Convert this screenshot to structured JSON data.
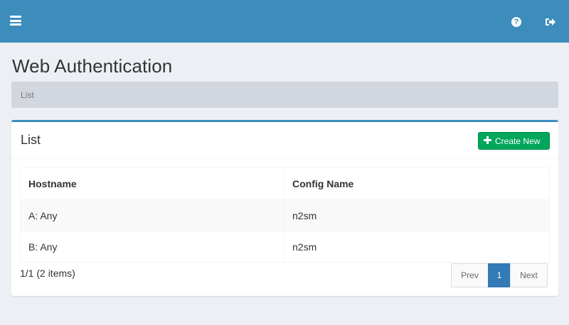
{
  "header": {
    "menu_icon": "hamburger-menu-icon",
    "help_icon": "question-circle-icon",
    "help_glyph": "?",
    "signout_icon": "sign-out-icon",
    "color": "#3c8dbc"
  },
  "page": {
    "title": "Web Authentication"
  },
  "breadcrumb": {
    "current": "List"
  },
  "box": {
    "title": "List",
    "create_button_label": "Create New",
    "create_button_icon": "plus-icon",
    "create_button_color": "#00a65a"
  },
  "table": {
    "columns": [
      "Hostname",
      "Config Name"
    ],
    "rows": [
      [
        "A: Any",
        "n2sm"
      ],
      [
        "B: Any",
        "n2sm"
      ]
    ]
  },
  "footer": {
    "summary": "1/1 (2 items)"
  },
  "pagination": {
    "prev_label": "Prev",
    "current_page": "1",
    "next_label": "Next",
    "active_color": "#337ab7"
  }
}
